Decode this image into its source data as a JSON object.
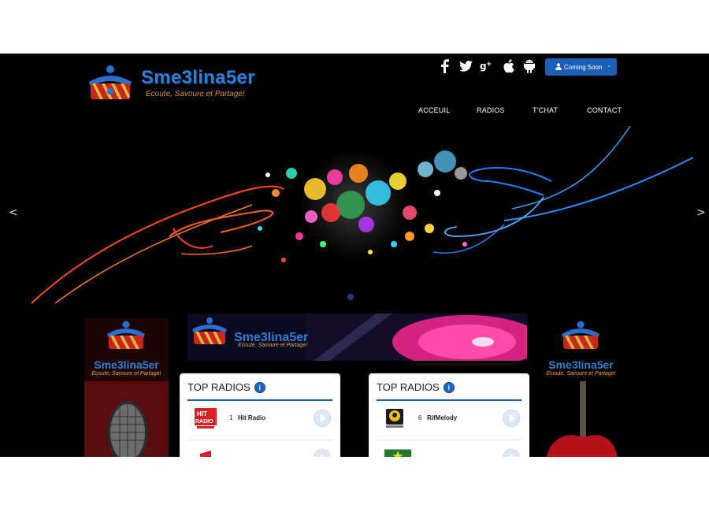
{
  "brand": {
    "title": "Sme3lina5er",
    "tagline": "Ecoute, Savoure et Partage!"
  },
  "header": {
    "social_icons": [
      "facebook-icon",
      "twitter-icon",
      "google-plus-icon",
      "apple-icon",
      "android-icon"
    ],
    "coming_soon_label": "Coming Soon"
  },
  "nav": {
    "items": [
      "ACCEUIL",
      "RADIOS",
      "T'CHAT",
      "CONTACT"
    ],
    "active": "ACCEUIL"
  },
  "slider": {
    "prev": "<",
    "next": ">",
    "slide_count": 1,
    "active_slide": 1
  },
  "banner": {
    "title": "Sme3lina5er",
    "tagline": "Ecoute, Savoure et Partage!"
  },
  "side_left": {
    "title": "Sme3lina5er",
    "tagline": "Ecoute, Savoure et Partage!"
  },
  "side_right": {
    "title": "Sme3lina5er",
    "tagline": "Ecoute, Savoure et Partage!"
  },
  "top_radios_1": {
    "title": "TOP RADIOS",
    "info_glyph": "i",
    "rows": [
      {
        "rank": "1",
        "name": "Hit Radio",
        "logo": "hit-radio-logo"
      },
      {
        "rank": "",
        "name": "",
        "logo": "radio-logo"
      }
    ]
  },
  "top_radios_2": {
    "title": "TOP RADIOS",
    "info_glyph": "i",
    "rows": [
      {
        "rank": "6",
        "name": "RifMelody",
        "logo": "rifmelody-logo"
      },
      {
        "rank": "",
        "name": "",
        "logo": "radio-logo"
      }
    ]
  },
  "colors": {
    "accent": "#1d5fb5",
    "brand_blue": "#2f7fd6",
    "brand_orange": "#e0902c",
    "background": "#000000"
  }
}
